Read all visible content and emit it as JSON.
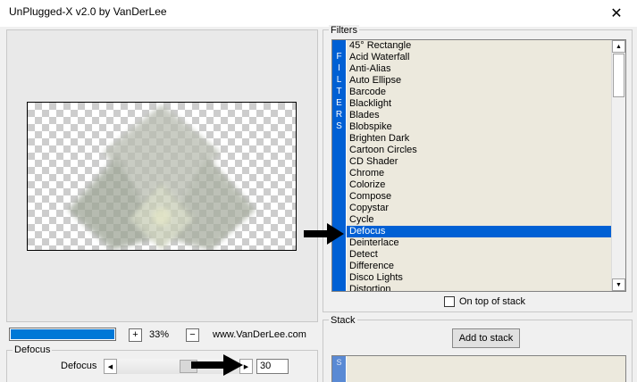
{
  "window": {
    "title": "UnPlugged-X v2.0 by VanDerLee",
    "close_icon": "close-icon"
  },
  "preview": {
    "zoom_plus": "+",
    "zoom_value": "33%",
    "zoom_minus": "−",
    "website": "www.VanDerLee.com",
    "progress_fraction": 1.0
  },
  "defocus_group": {
    "title": "Defocus",
    "param_label": "Defocus",
    "value": "30",
    "slider_level": 0.6
  },
  "filters": {
    "title": "Filters",
    "band_letters": [
      "F",
      "I",
      "L",
      "T",
      "E",
      "R",
      "S"
    ],
    "items": [
      "45° Rectangle",
      "Acid Waterfall",
      "Anti-Alias",
      "Auto Ellipse",
      "Barcode",
      "Blacklight",
      "Blades",
      "Blobspike",
      "Brighten Dark",
      "Cartoon Circles",
      "CD Shader",
      "Chrome",
      "Colorize",
      "Compose",
      "Copystar",
      "Cycle",
      "Defocus",
      "Deinterlace",
      "Detect",
      "Difference",
      "Disco Lights",
      "Distortion"
    ],
    "selected_index": 16,
    "on_top_label": "On top of stack",
    "on_top_checked": false
  },
  "stack": {
    "title": "Stack",
    "add_button": "Add to stack",
    "band_letter": "S"
  },
  "colors": {
    "selection": "#0060d4",
    "progress": "#0078d7",
    "list_bg": "#ece9dd"
  }
}
